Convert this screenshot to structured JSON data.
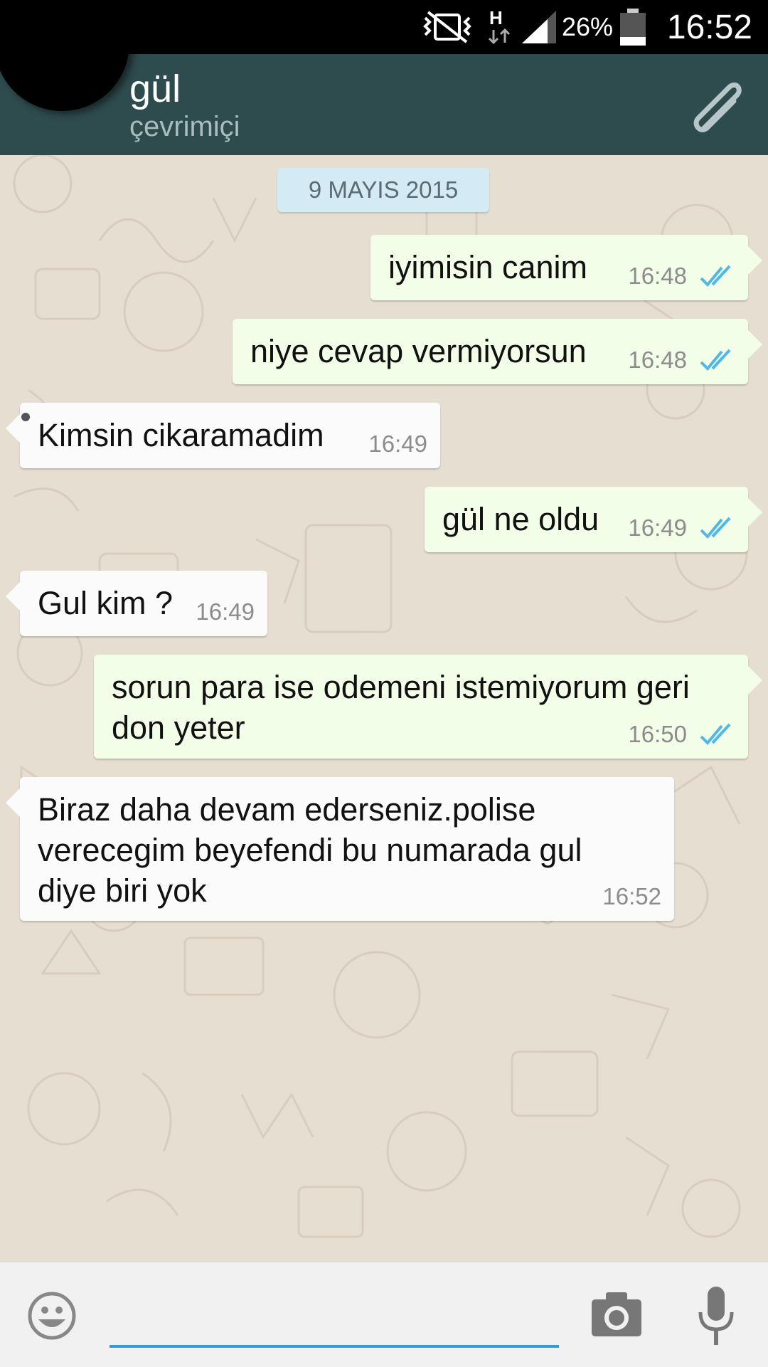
{
  "status_bar": {
    "battery_percent": "26%",
    "time": "16:52",
    "icons": [
      "mute-vibrate-icon",
      "hspa-data-icon",
      "signal-icon",
      "battery-icon"
    ]
  },
  "header": {
    "contact_name": "gül",
    "contact_status": "çevrimiçi",
    "attach_icon": "paperclip-icon",
    "colors": {
      "app_bar": "#2e4b4e",
      "status_text": "#a9bdbd"
    }
  },
  "chat": {
    "date_label": "9 MAYIS 2015",
    "messages": [
      {
        "direction": "out",
        "text": "iyimisin canim",
        "time": "16:48",
        "status": "read"
      },
      {
        "direction": "out",
        "text": "niye cevap vermiyorsun",
        "time": "16:48",
        "status": "read"
      },
      {
        "direction": "in",
        "text": "Kimsin cikaramadim",
        "time": "16:49"
      },
      {
        "direction": "out",
        "text": "gül ne oldu",
        "time": "16:49",
        "status": "read"
      },
      {
        "direction": "in",
        "text": "Gul kim ?",
        "time": "16:49"
      },
      {
        "direction": "out",
        "text_lines": [
          "sorun para ise odemeni istemiyorum geri",
          "don yeter"
        ],
        "time": "16:50",
        "status": "read"
      },
      {
        "direction": "in",
        "text_lines": [
          "Biraz daha devam ederseniz.polise",
          "verecegim beyefendi bu numarada gul",
          "diye biri yok"
        ],
        "time": "16:52"
      }
    ],
    "colors": {
      "outgoing_bubble": "#f3fee8",
      "incoming_bubble": "#fbfbfb",
      "read_ticks": "#4fb8e8"
    }
  },
  "composer": {
    "input_value": "",
    "icons": [
      "emoji-icon",
      "camera-icon",
      "microphone-icon"
    ],
    "colors": {
      "input_underline": "#2d9cd8"
    }
  }
}
